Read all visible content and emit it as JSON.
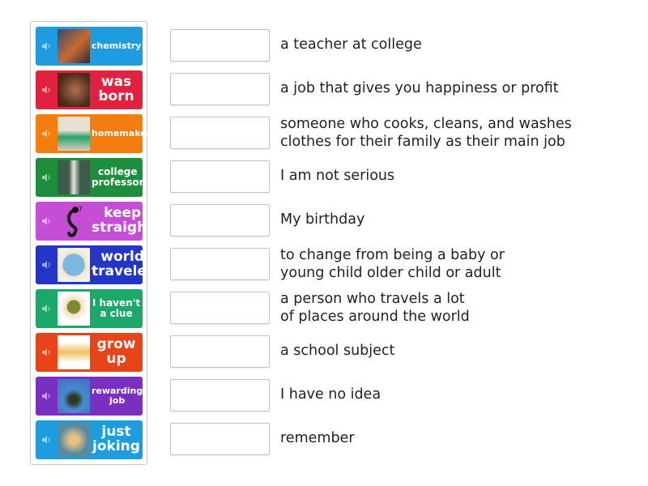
{
  "tiles": [
    {
      "label": "chemistry",
      "color": "#1f9ce0",
      "image": "chemistry-photo",
      "size": "s"
    },
    {
      "label": "was born",
      "color": "#e0213f",
      "image": "baby-photo",
      "size": "l"
    },
    {
      "label": "homemaker",
      "color": "#f47d10",
      "image": "homemaker-photo",
      "size": "s"
    },
    {
      "label": "college professor",
      "color": "#1d8f3c",
      "image": "professor-photo",
      "size": "m"
    },
    {
      "label": "keep straight",
      "color": "#c64ed6",
      "image": "thinking-figure-icon",
      "size": "l"
    },
    {
      "label": "world traveler",
      "color": "#2535c6",
      "image": "globe-logo",
      "size": "l"
    },
    {
      "label": "I haven't a clue",
      "color": "#1ba86a",
      "image": "shrugging-man-cartoon",
      "size": "m"
    },
    {
      "label": "grow up",
      "color": "#e84419",
      "image": "growth-stages-cartoon",
      "size": "l"
    },
    {
      "label": "rewarding job",
      "color": "#7b2fc0",
      "image": "money-rain-photo",
      "size": "s"
    },
    {
      "label": "just joking",
      "color": "#1b9de0",
      "image": "woman-smiling-photo",
      "size": "l"
    }
  ],
  "definitions": [
    "a teacher at college",
    "a job that gives you happiness or profit",
    "someone who cooks, cleans, and washes\nclothes for their family as their main job",
    "I am not serious",
    "My birthday",
    "to change from being a baby or\nyoung child older child or adult",
    "a person who travels a lot\nof places around the world",
    "a school subject",
    "I have no idea",
    "remember"
  ]
}
